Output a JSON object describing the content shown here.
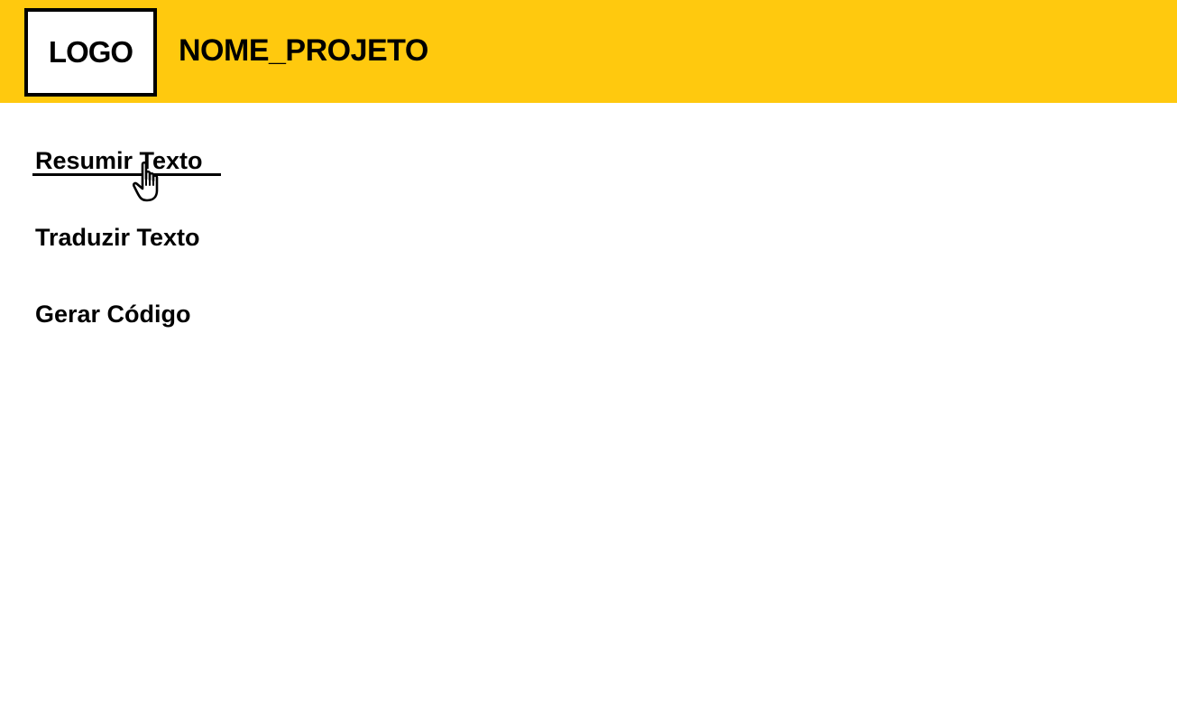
{
  "header": {
    "logo_label": "LOGO",
    "project_name": "NOME_PROJETO",
    "background_color": "#FFC90E"
  },
  "menu": {
    "items": [
      {
        "label": "Resumir Texto",
        "active": true
      },
      {
        "label": "Traduzir Texto",
        "active": false
      },
      {
        "label": "Gerar Código",
        "active": false
      }
    ]
  },
  "cursor": {
    "icon": "hand-pointer-icon"
  }
}
